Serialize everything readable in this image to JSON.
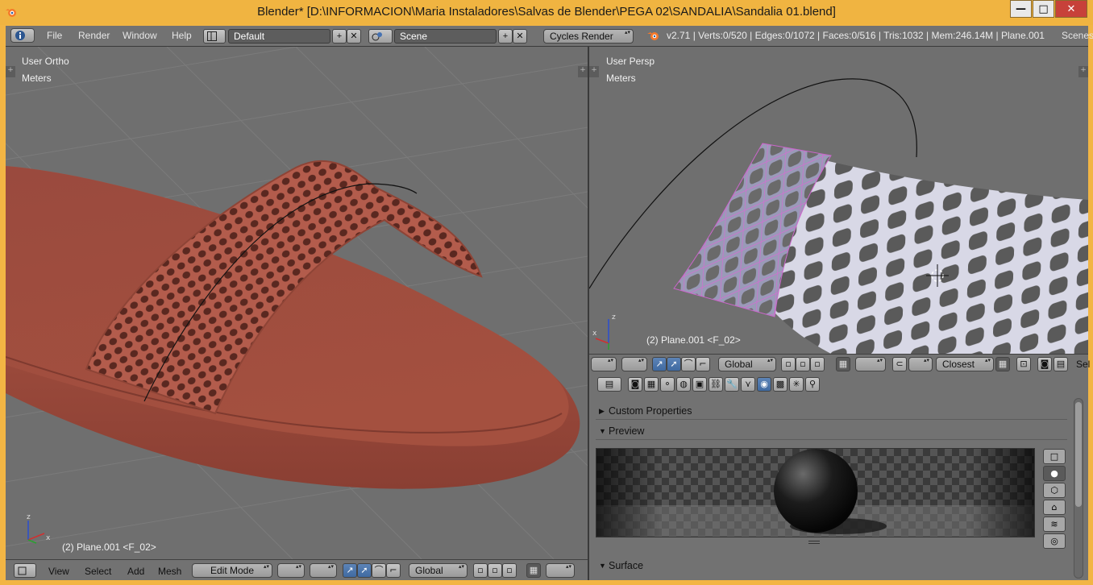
{
  "window": {
    "title": "Blender* [D:\\INFORMACION\\Maria Instaladores\\Salvas de Blender\\PEGA 02\\SANDALIA\\Sandalia 01.blend]",
    "minimize": "—",
    "maximize": "□",
    "close": "✕"
  },
  "topbar": {
    "menus": [
      "File",
      "Render",
      "Window",
      "Help"
    ],
    "layout": "Default",
    "scene": "Scene",
    "engine": "Cycles Render",
    "stats": "v2.71 | Verts:0/520 | Edges:0/1072 | Faces:0/516 | Tris:1032 | Mem:246.14M | Plane.001",
    "right_label": "Scenes"
  },
  "left_view": {
    "view_name": "User Ortho",
    "units": "Meters",
    "object_label": "(2) Plane.001 <F_02>",
    "axis": {
      "z": "z",
      "x": "x"
    }
  },
  "right_view": {
    "view_name": "User Persp",
    "units": "Meters",
    "object_label": "(2) Plane.001 <F_02>",
    "axis": {
      "z": "z",
      "x": "x"
    }
  },
  "left_header": {
    "menus": [
      "View",
      "Select",
      "Add",
      "Mesh"
    ],
    "mode": "Edit Mode",
    "orientation": "Global"
  },
  "right_header": {
    "orientation": "Global",
    "snap_target": "Closest",
    "trailing": "Sel"
  },
  "properties": {
    "panels": [
      "Custom Properties",
      "Preview",
      "Surface"
    ]
  }
}
